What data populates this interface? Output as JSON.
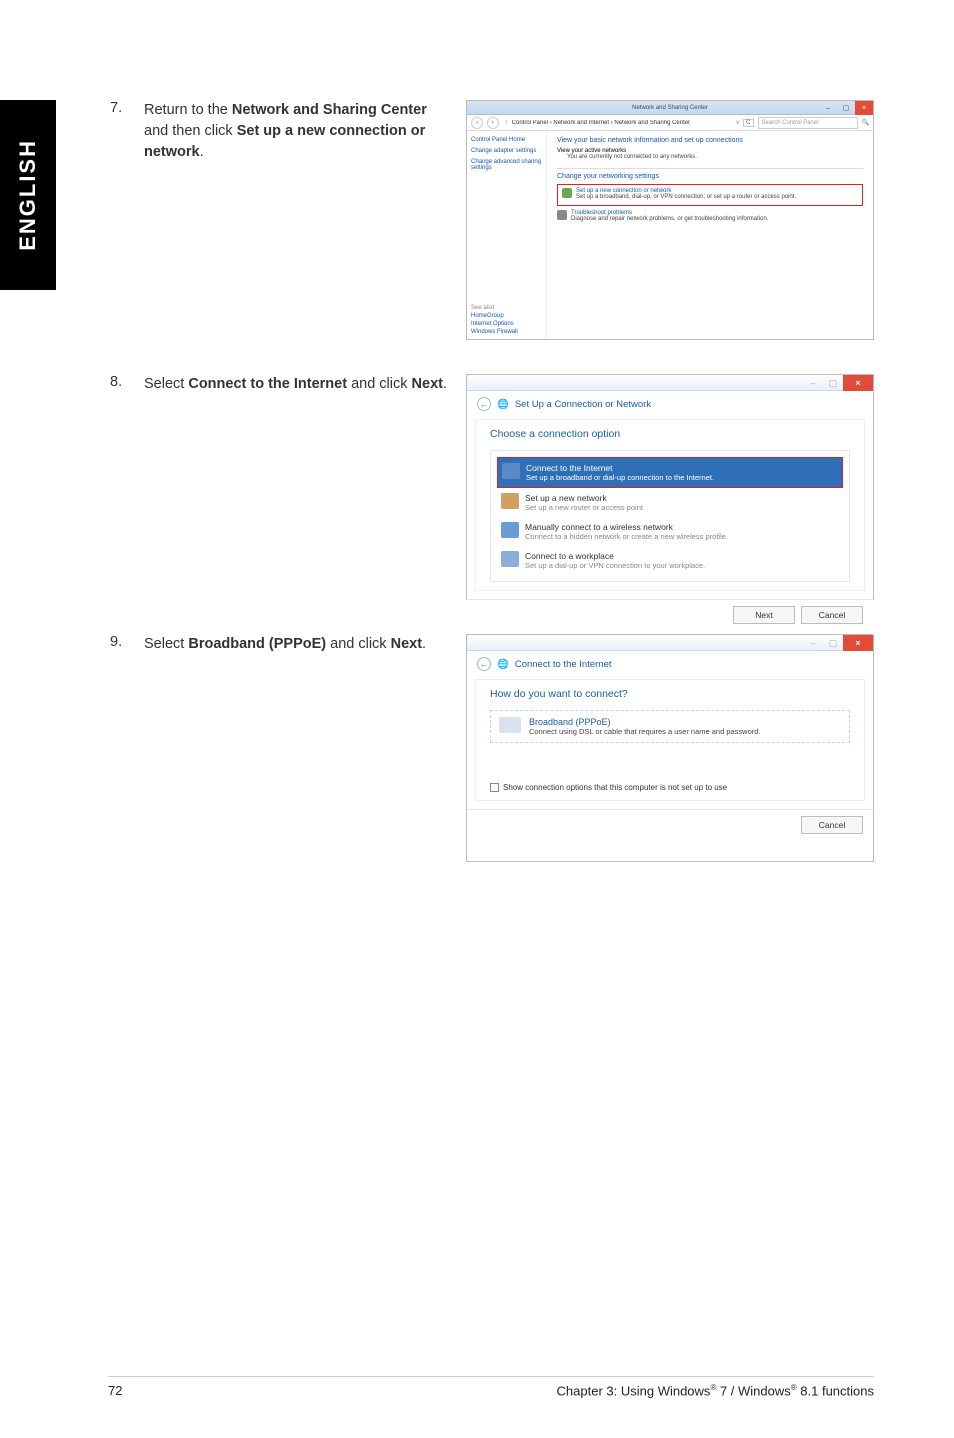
{
  "sidebar_label": "ENGLISH",
  "steps": {
    "s7": {
      "num": "7.",
      "parts": [
        "Return to the ",
        "Network and Sharing Center",
        " and then click ",
        "Set up a new connection or network",
        "."
      ]
    },
    "s8": {
      "num": "8.",
      "parts": [
        "Select ",
        "Connect to the Internet",
        " and click ",
        "Next",
        "."
      ]
    },
    "s9": {
      "num": "9.",
      "parts": [
        "Select ",
        "Broadband (PPPoE)",
        " and click ",
        "Next",
        "."
      ]
    }
  },
  "shot1": {
    "title": "Network and Sharing Center",
    "breadcrumbs": "Control Panel  ›  Network and Internet  ›  Network and Sharing Center",
    "search_placeholder": "Search Control Panel",
    "side_links": [
      "Control Panel Home",
      "Change adapter settings",
      "Change advanced sharing settings"
    ],
    "main_head": "View your basic network information and set up connections",
    "active_label": "View your active networks",
    "active_note": "You are currently not connected to any networks.",
    "change_head": "Change your networking settings",
    "setup_link": "Set up a new connection or network",
    "setup_desc": "Set up a broadband, dial-up, or VPN connection; or set up a router or access point.",
    "trouble_link": "Troubleshoot problems",
    "trouble_desc": "Diagnose and repair network problems, or get troubleshooting information.",
    "see_also_head": "See also",
    "see_also": [
      "HomeGroup",
      "Internet Options",
      "Windows Firewall"
    ]
  },
  "shot2": {
    "title": "Set Up a Connection or Network",
    "choose": "Choose a connection option",
    "options": [
      {
        "title": "Connect to the Internet",
        "desc": "Set up a broadband or dial-up connection to the Internet."
      },
      {
        "title": "Set up a new network",
        "desc": "Set up a new router or access point."
      },
      {
        "title": "Manually connect to a wireless network",
        "desc": "Connect to a hidden network or create a new wireless profile."
      },
      {
        "title": "Connect to a workplace",
        "desc": "Set up a dial-up or VPN connection to your workplace."
      }
    ],
    "next": "Next",
    "cancel": "Cancel"
  },
  "shot3": {
    "title": "Connect to the Internet",
    "how": "How do you want to connect?",
    "bb_title": "Broadband (PPPoE)",
    "bb_desc": "Connect using DSL or cable that requires a user name and password.",
    "show_opts": "Show connection options that this computer is not set up to use",
    "cancel": "Cancel"
  },
  "footer": {
    "page": "72",
    "chapter_prefix": "Chapter 3: Using Windows",
    "mid": " 7 / Windows",
    "suffix": " 8.1 functions",
    "reg": "®"
  }
}
